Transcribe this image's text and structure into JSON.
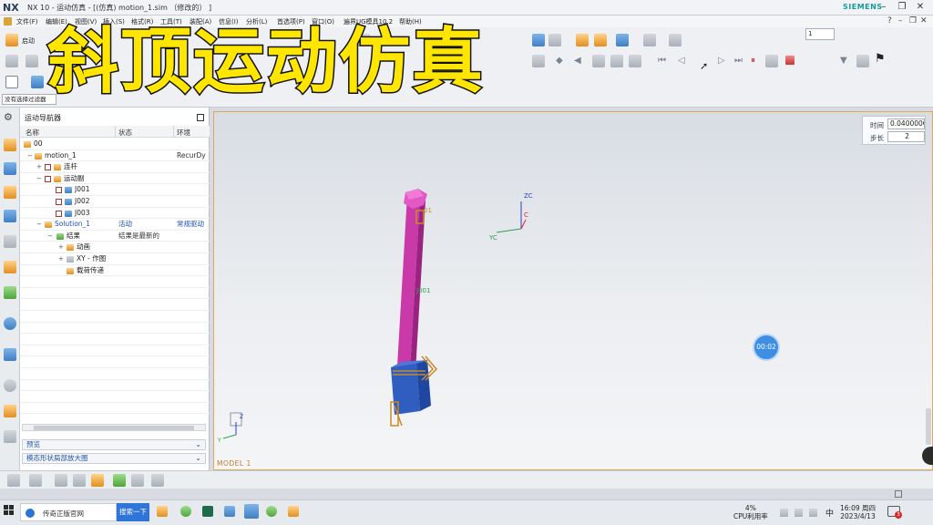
{
  "window": {
    "logo": "NX",
    "title": "NX 10 - 运动仿真 - [(仿真) motion_1.sim （修改的） ]",
    "brand": "SIEMENS",
    "controls": [
      "–",
      "❐",
      "✕"
    ]
  },
  "menu": {
    "items": [
      "文件(F)",
      "编辑(E)",
      "视图(V)",
      "插入(S)",
      "格式(R)",
      "工具(T)",
      "装配(A)",
      "信息(I)",
      "分析(L)",
      "首选项(P)",
      "窗口(O)",
      "遍界UG模具10.2",
      "帮助(H)"
    ],
    "controls": [
      "?",
      "–",
      "❐",
      "✕"
    ]
  },
  "overlay_caption": "斜顶运动仿真",
  "ribbon": {
    "start_label": "启动",
    "frame_value": "1",
    "selection_filter": "没有选择过滤器"
  },
  "navigator": {
    "title": "运动导航器",
    "columns": [
      "名称",
      "状态",
      "环境"
    ],
    "rows": [
      {
        "label": "00",
        "status": "",
        "env": ""
      },
      {
        "label": "motion_1",
        "status": "",
        "env": "RecurDy"
      },
      {
        "label": "连杆",
        "status": "",
        "env": ""
      },
      {
        "label": "运动副",
        "status": "",
        "env": ""
      },
      {
        "label": "J001",
        "status": "",
        "env": ""
      },
      {
        "label": "J002",
        "status": "",
        "env": ""
      },
      {
        "label": "J003",
        "status": "",
        "env": ""
      },
      {
        "label": "Solution_1",
        "status": "活动",
        "env": "常规驱动"
      },
      {
        "label": "结果",
        "status": "结果是最新的",
        "env": ""
      },
      {
        "label": "动画",
        "status": "",
        "env": ""
      },
      {
        "label": "XY - 作图",
        "status": "",
        "env": ""
      },
      {
        "label": "载荷传递",
        "status": "",
        "env": ""
      }
    ],
    "sections": [
      "预览",
      "模态形状局部放大图"
    ]
  },
  "viewport": {
    "model_label": "MODEL 1",
    "axis_labels": {
      "zc": "ZC",
      "yc": "YC",
      "c": "C",
      "z": "Z",
      "y": "Y"
    },
    "part_labels": {
      "j1": "01",
      "j2": "J001"
    },
    "timer": "00:02"
  },
  "animation": {
    "time_label": "时间",
    "time_value": "0.040000C",
    "step_label": "步长",
    "step_value": "2"
  },
  "taskbar": {
    "browser_tab": "传奇正版官网",
    "search_button": "搜索一下",
    "cpu_percent": "4%",
    "cpu_label": "CPU利用率",
    "ime": "中",
    "time": "16:09 周四",
    "date": "2023/4/13",
    "notification_count": "3"
  },
  "colors": {
    "accent": "#d72a9c",
    "base_block": "#2f5dc0",
    "viewport_border": "#e0a75f",
    "overlay": "#ffe600"
  }
}
